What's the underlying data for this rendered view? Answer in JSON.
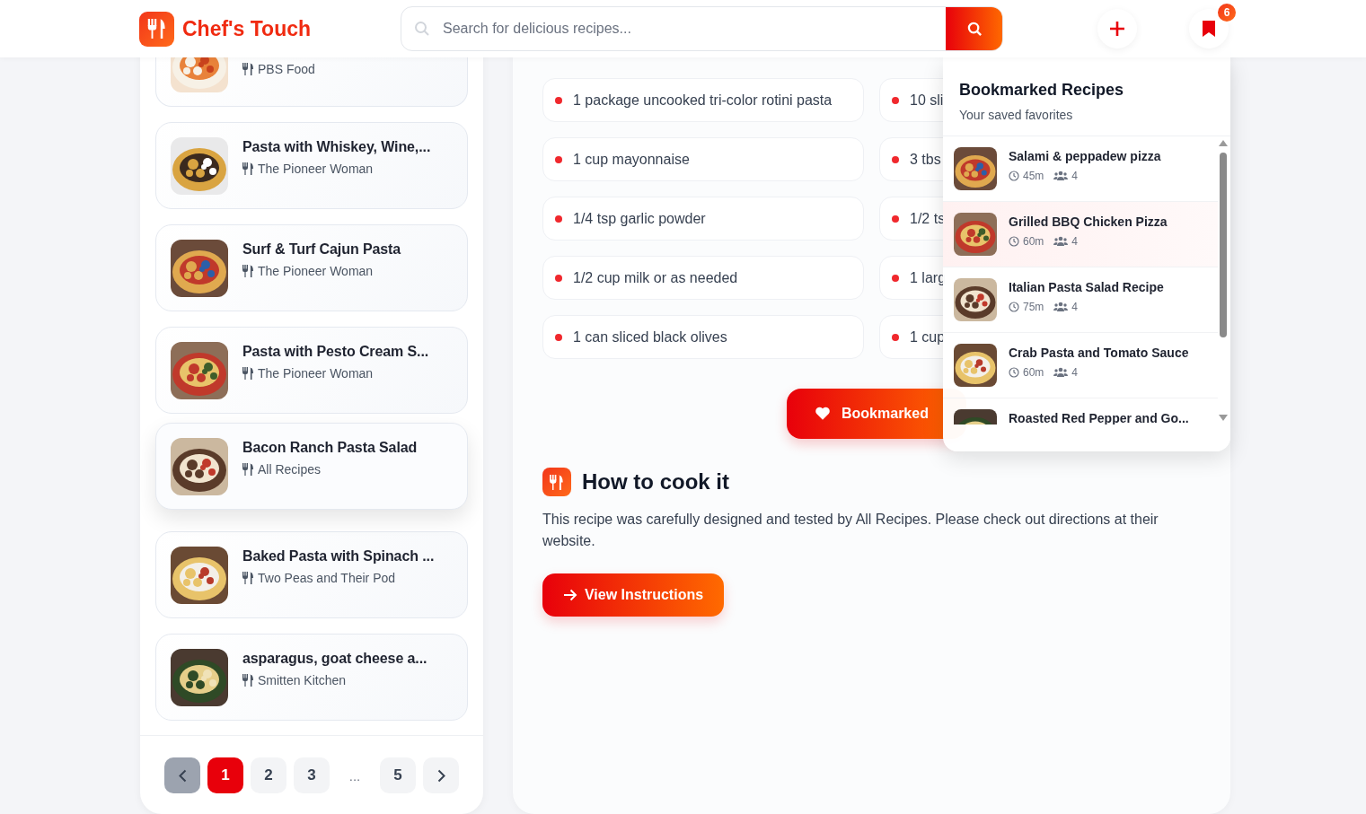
{
  "header": {
    "logo": "Chef's Touch",
    "search": {
      "placeholder": "Search for delicious recipes..."
    },
    "bookmark_count": "6"
  },
  "recipes": [
    {
      "source": "PBS Food",
      "highlighted": false
    },
    {
      "title": "Pasta with Whiskey, Wine,...",
      "source": "The Pioneer Woman",
      "highlighted": false
    },
    {
      "title": "Surf & Turf Cajun Pasta",
      "source": "The Pioneer Woman",
      "highlighted": false
    },
    {
      "title": "Pasta with Pesto Cream S...",
      "source": "The Pioneer Woman",
      "highlighted": false
    },
    {
      "title": "Bacon Ranch Pasta Salad",
      "source": "All Recipes",
      "highlighted": true
    },
    {
      "title": "Baked Pasta with Spinach ...",
      "source": "Two Peas and Their Pod",
      "highlighted": false
    },
    {
      "title": "asparagus, goat cheese a...",
      "source": "Smitten Kitchen",
      "highlighted": false
    }
  ],
  "pagination": {
    "prev_disabled": true,
    "next_disabled": false,
    "pages": [
      {
        "kind": "page",
        "label": "1",
        "selected": true
      },
      {
        "kind": "page",
        "label": "2",
        "selected": false
      },
      {
        "kind": "page",
        "label": "3",
        "selected": false
      },
      {
        "kind": "gap",
        "label": "..."
      },
      {
        "kind": "page",
        "label": "5",
        "selected": false
      }
    ]
  },
  "ingredients": [
    {
      "text": "1 package uncooked tri-color rotini pasta"
    },
    {
      "text": "10 sli"
    },
    {
      "text": "1 cup mayonnaise"
    },
    {
      "text": "3 tbs"
    },
    {
      "text": "1/4 tsp garlic powder"
    },
    {
      "text": "1/2 ts"
    },
    {
      "text": "1/2 cup milk or as needed"
    },
    {
      "text": "1 larg"
    },
    {
      "text": "1 can sliced black olives"
    },
    {
      "text": "1 cup"
    }
  ],
  "bookmark_button": {
    "label": "Bookmarked",
    "bookmarked": true
  },
  "instructions": {
    "title": "How to cook it",
    "text": "This recipe was carefully designed and tested by All Recipes. Please check out directions at their website.",
    "button": "View Instructions"
  },
  "bookmarks_popup": {
    "title": "Bookmarked Recipes",
    "subtitle": "Your saved favorites",
    "items": [
      {
        "title": "Salami & peppadew pizza",
        "time": "45m",
        "servings": "4",
        "highlighted": false
      },
      {
        "title": "Grilled BBQ Chicken Pizza",
        "time": "60m",
        "servings": "4",
        "highlighted": true
      },
      {
        "title": "Italian Pasta Salad Recipe",
        "time": "75m",
        "servings": "4",
        "highlighted": false
      },
      {
        "title": "Crab Pasta and Tomato Sauce",
        "time": "60m",
        "servings": "4",
        "highlighted": false
      },
      {
        "title": "Roasted Red Pepper and Go...",
        "highlighted": false
      }
    ]
  }
}
